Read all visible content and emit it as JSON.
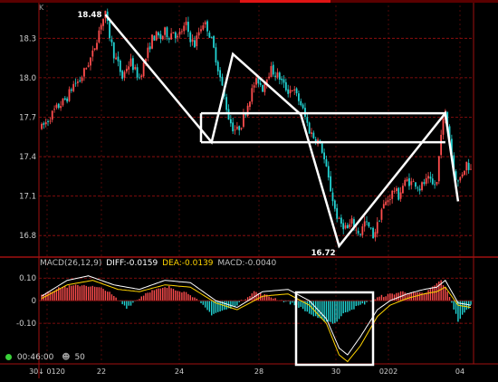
{
  "header": {
    "corner_label": "K"
  },
  "price_panel": {
    "y_ticks": [
      "18.3",
      "18.0",
      "17.7",
      "17.4",
      "17.1",
      "16.8"
    ],
    "high_label": "18.48",
    "low_label": "16.72"
  },
  "macd_panel": {
    "name": "MACD(26,12,9)",
    "diff_label": "DIFF:",
    "diff_value": "-0.0159",
    "dea_label": "DEA:",
    "dea_value": "-0.0139",
    "macd_label": "MACD:",
    "macd_value": "-0.0040",
    "y_ticks": [
      "0.10",
      "0",
      "-0.10"
    ]
  },
  "x_ticks": [
    "30↓ 0120",
    "22",
    "24",
    "28",
    "30",
    "0202",
    "04"
  ],
  "status": {
    "time": "00:46:00",
    "count": "50"
  },
  "colors": {
    "background": "#000000",
    "up": "#ff4d4d",
    "down": "#22d3d3",
    "grid": "#a01010",
    "overlay": "#ffffff",
    "dea": "#ffd400",
    "diff": "#ffffff",
    "status_dot": "#39d039",
    "top_accent": "#e01414"
  },
  "chart_data": [
    {
      "type": "candlestick",
      "title": "",
      "ylim": [
        16.65,
        18.55
      ],
      "x_tick_labels": [
        "30↓ 0120",
        "22",
        "24",
        "28",
        "30",
        "0202",
        "04"
      ],
      "y_ticks": [
        18.3,
        18.0,
        17.7,
        17.4,
        17.1,
        16.8
      ],
      "close_path": [
        [
          0,
          17.62
        ],
        [
          3,
          17.68
        ],
        [
          6,
          17.75
        ],
        [
          9,
          17.8
        ],
        [
          12,
          17.85
        ],
        [
          15,
          17.95
        ],
        [
          18,
          17.98
        ],
        [
          21,
          18.08
        ],
        [
          24,
          18.18
        ],
        [
          26,
          18.3
        ],
        [
          28,
          18.42
        ],
        [
          30,
          18.48
        ],
        [
          32,
          18.32
        ],
        [
          34,
          18.18
        ],
        [
          36,
          18.1
        ],
        [
          38,
          18.0
        ],
        [
          40,
          18.08
        ],
        [
          42,
          18.12
        ],
        [
          44,
          18.05
        ],
        [
          46,
          18.0
        ],
        [
          48,
          18.1
        ],
        [
          50,
          18.2
        ],
        [
          52,
          18.3
        ],
        [
          54,
          18.32
        ],
        [
          56,
          18.3
        ],
        [
          58,
          18.35
        ],
        [
          60,
          18.32
        ],
        [
          62,
          18.36
        ],
        [
          64,
          18.3
        ],
        [
          66,
          18.36
        ],
        [
          68,
          18.4
        ],
        [
          70,
          18.3
        ],
        [
          72,
          18.25
        ],
        [
          74,
          18.35
        ],
        [
          76,
          18.42
        ],
        [
          78,
          18.38
        ],
        [
          80,
          18.28
        ],
        [
          82,
          18.15
        ],
        [
          84,
          18.0
        ],
        [
          86,
          17.85
        ],
        [
          88,
          17.7
        ],
        [
          90,
          17.62
        ],
        [
          92,
          17.6
        ],
        [
          94,
          17.65
        ],
        [
          96,
          17.75
        ],
        [
          98,
          17.85
        ],
        [
          100,
          17.95
        ],
        [
          102,
          17.98
        ],
        [
          104,
          17.92
        ],
        [
          106,
          18.02
        ],
        [
          108,
          18.06
        ],
        [
          110,
          18.03
        ],
        [
          112,
          18.0
        ],
        [
          114,
          17.94
        ],
        [
          116,
          17.9
        ],
        [
          118,
          17.92
        ],
        [
          120,
          17.86
        ],
        [
          122,
          17.8
        ],
        [
          124,
          17.7
        ],
        [
          126,
          17.6
        ],
        [
          128,
          17.55
        ],
        [
          130,
          17.52
        ],
        [
          132,
          17.45
        ],
        [
          134,
          17.3
        ],
        [
          136,
          17.15
        ],
        [
          138,
          17.0
        ],
        [
          140,
          16.9
        ],
        [
          142,
          16.88
        ],
        [
          144,
          16.85
        ],
        [
          146,
          16.9
        ],
        [
          148,
          16.84
        ],
        [
          150,
          16.82
        ],
        [
          152,
          16.9
        ],
        [
          154,
          16.86
        ],
        [
          156,
          16.8
        ],
        [
          158,
          16.88
        ],
        [
          160,
          17.0
        ],
        [
          162,
          17.05
        ],
        [
          164,
          17.1
        ],
        [
          166,
          17.15
        ],
        [
          168,
          17.1
        ],
        [
          170,
          17.18
        ],
        [
          172,
          17.22
        ],
        [
          174,
          17.2
        ],
        [
          176,
          17.2
        ],
        [
          178,
          17.16
        ],
        [
          180,
          17.2
        ],
        [
          182,
          17.22
        ],
        [
          184,
          17.18
        ],
        [
          186,
          17.2
        ],
        [
          188,
          17.6
        ],
        [
          190,
          17.73
        ],
        [
          192,
          17.55
        ],
        [
          194,
          17.3
        ],
        [
          196,
          17.2
        ],
        [
          198,
          17.28
        ],
        [
          200,
          17.35
        ],
        [
          202,
          17.3
        ]
      ]
    },
    {
      "type": "bar+line",
      "title": "MACD(26,12,9)",
      "ylim": [
        -0.28,
        0.145
      ],
      "y_ticks": [
        0.1,
        0,
        -0.1
      ],
      "macd_hist_path": [
        [
          0,
          0.03
        ],
        [
          10,
          0.06
        ],
        [
          20,
          0.07
        ],
        [
          30,
          0.05
        ],
        [
          40,
          -0.03
        ],
        [
          50,
          0.04
        ],
        [
          60,
          0.06
        ],
        [
          70,
          0.03
        ],
        [
          80,
          -0.06
        ],
        [
          90,
          -0.03
        ],
        [
          100,
          0.04
        ],
        [
          110,
          0.01
        ],
        [
          120,
          -0.02
        ],
        [
          130,
          -0.08
        ],
        [
          138,
          -0.1
        ],
        [
          143,
          -0.05
        ],
        [
          150,
          -0.02
        ],
        [
          160,
          0.02
        ],
        [
          170,
          0.04
        ],
        [
          180,
          0.03
        ],
        [
          188,
          0.09
        ],
        [
          192,
          0.02
        ],
        [
          196,
          -0.09
        ],
        [
          202,
          -0.02
        ]
      ],
      "series": [
        {
          "name": "DEA",
          "values": [
            [
              0,
              0.01
            ],
            [
              12,
              0.07
            ],
            [
              24,
              0.09
            ],
            [
              36,
              0.05
            ],
            [
              46,
              0.04
            ],
            [
              58,
              0.07
            ],
            [
              70,
              0.06
            ],
            [
              82,
              -0.01
            ],
            [
              92,
              -0.04
            ],
            [
              104,
              0.02
            ],
            [
              116,
              0.03
            ],
            [
              126,
              -0.02
            ],
            [
              134,
              -0.1
            ],
            [
              140,
              -0.24
            ],
            [
              144,
              -0.27
            ],
            [
              150,
              -0.2
            ],
            [
              158,
              -0.07
            ],
            [
              164,
              -0.02
            ],
            [
              172,
              0.01
            ],
            [
              180,
              0.03
            ],
            [
              186,
              0.04
            ],
            [
              190,
              0.06
            ],
            [
              196,
              -0.02
            ],
            [
              202,
              -0.03
            ]
          ]
        },
        {
          "name": "DIFF",
          "values": [
            [
              0,
              0.02
            ],
            [
              12,
              0.09
            ],
            [
              22,
              0.11
            ],
            [
              34,
              0.07
            ],
            [
              46,
              0.05
            ],
            [
              58,
              0.09
            ],
            [
              70,
              0.08
            ],
            [
              82,
              0.0
            ],
            [
              92,
              -0.03
            ],
            [
              104,
              0.04
            ],
            [
              116,
              0.05
            ],
            [
              126,
              0.0
            ],
            [
              134,
              -0.08
            ],
            [
              140,
              -0.21
            ],
            [
              144,
              -0.24
            ],
            [
              150,
              -0.16
            ],
            [
              158,
              -0.04
            ],
            [
              164,
              0.0
            ],
            [
              172,
              0.03
            ],
            [
              180,
              0.05
            ],
            [
              186,
              0.06
            ],
            [
              190,
              0.09
            ],
            [
              196,
              -0.01
            ],
            [
              202,
              -0.02
            ]
          ]
        }
      ]
    }
  ]
}
